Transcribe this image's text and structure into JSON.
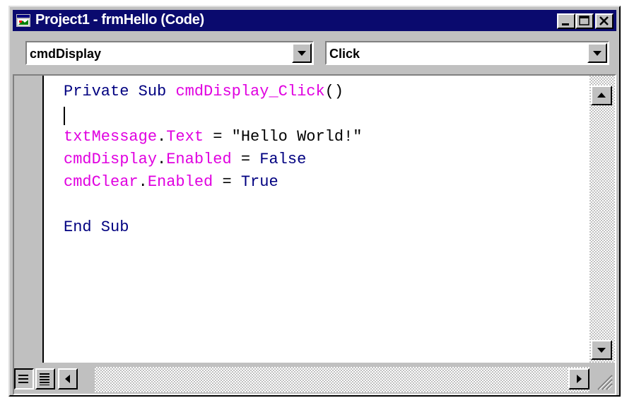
{
  "window": {
    "title": "Project1 - frmHello (Code)",
    "colors": {
      "titlebar": "#0a0a6e",
      "keyword": "#000080",
      "identifier": "#e000e0",
      "chrome": "#c0c0c0"
    }
  },
  "object_combo": {
    "value": "cmdDisplay"
  },
  "procedure_combo": {
    "value": "Click"
  },
  "code": {
    "line1": {
      "kw1": "Private Sub ",
      "id1": "cmdDisplay_Click",
      "tx1": "()"
    },
    "line3": {
      "id1": "txtMessage",
      "tx1": ".",
      "id2": "Text",
      "tx2": " = \"Hello World!\""
    },
    "line4": {
      "id1": "cmdDisplay",
      "tx1": ".",
      "id2": "Enabled",
      "tx2": " = ",
      "kw1": "False"
    },
    "line5": {
      "id1": "cmdClear",
      "tx1": ".",
      "id2": "Enabled",
      "tx2": " = ",
      "kw1": "True"
    },
    "line7": {
      "kw1": "End Sub"
    }
  },
  "icons": {
    "app": "vb-form-icon",
    "minimize": "minimize-icon",
    "maximize": "maximize-icon",
    "close": "close-icon",
    "procedure_view": "procedure-view-icon",
    "full_module_view": "full-module-view-icon"
  }
}
